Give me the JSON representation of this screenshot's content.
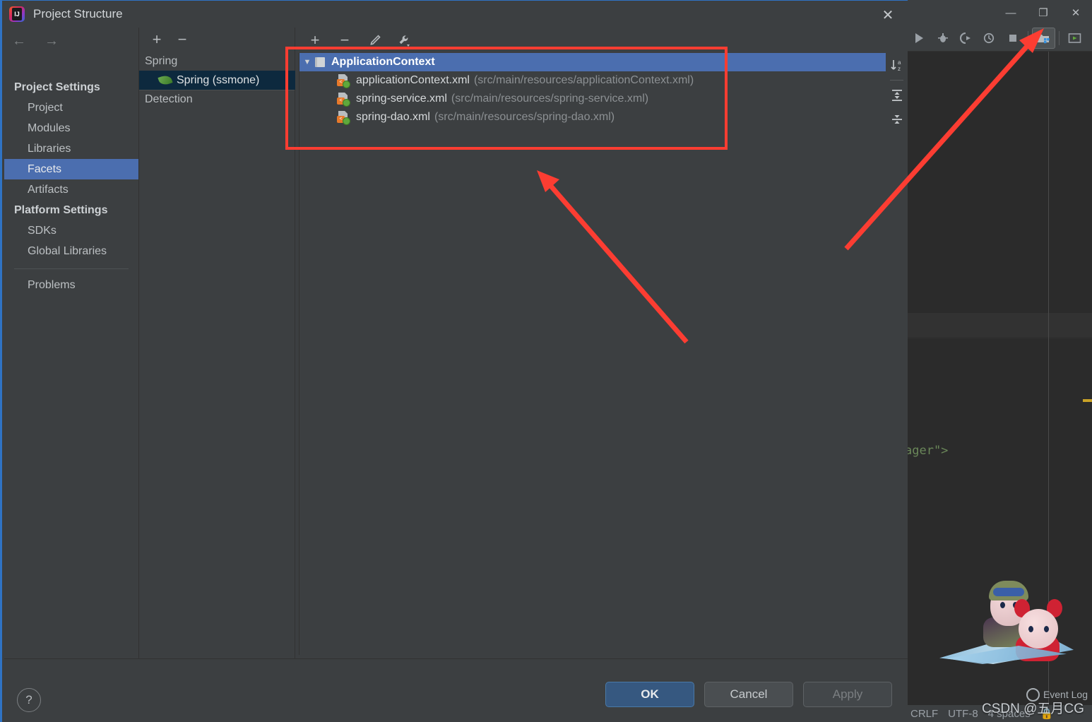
{
  "dialog": {
    "title": "Project Structure",
    "close_label": "✕",
    "nav": {
      "back": "←",
      "forward": "→"
    },
    "sidebar": {
      "groups": [
        {
          "label": "Project Settings",
          "type": "group"
        },
        {
          "label": "Project",
          "type": "item"
        },
        {
          "label": "Modules",
          "type": "item"
        },
        {
          "label": "Libraries",
          "type": "item"
        },
        {
          "label": "Facets",
          "type": "item",
          "selected": true
        },
        {
          "label": "Artifacts",
          "type": "item"
        },
        {
          "label": "Platform Settings",
          "type": "group"
        },
        {
          "label": "SDKs",
          "type": "item"
        },
        {
          "label": "Global Libraries",
          "type": "item"
        }
      ],
      "after_divider": [
        {
          "label": "Problems",
          "type": "item"
        }
      ]
    },
    "facets_panel": {
      "toolbar": {
        "add": "+",
        "remove": "−"
      },
      "header": "Spring",
      "selected_facet": "Spring (ssmone)",
      "facet_icon": "spring-leaf-icon",
      "section2": "Detection"
    },
    "content_panel": {
      "toolbar": {
        "add": "+",
        "remove": "−",
        "edit": "pencil-icon",
        "settings": "wrench-icon"
      },
      "tree": [
        {
          "label": "ApplicationContext",
          "path": "",
          "level": 0,
          "selected": true,
          "expanded": true,
          "icon": "application-context-icon"
        },
        {
          "label": "applicationContext.xml",
          "path": "(src/main/resources/applicationContext.xml)",
          "level": 1,
          "selected": false,
          "icon": "spring-xml-file-icon"
        },
        {
          "label": "spring-service.xml",
          "path": "(src/main/resources/spring-service.xml)",
          "level": 1,
          "selected": false,
          "icon": "spring-xml-file-icon"
        },
        {
          "label": "spring-dao.xml",
          "path": "(src/main/resources/spring-dao.xml)",
          "level": 1,
          "selected": false,
          "icon": "spring-xml-file-icon"
        }
      ],
      "rail": {
        "sort": "sort-alphabetically-icon",
        "expand_all": "expand-all-icon",
        "collapse_all": "collapse-all-icon"
      }
    },
    "footer": {
      "help": "?",
      "ok": "OK",
      "cancel": "Cancel",
      "apply": "Apply"
    }
  },
  "ide": {
    "window_controls": {
      "minimize": "—",
      "restore": "❐",
      "close": "✕"
    },
    "toolbar_icons": [
      "run-icon",
      "debug-icon",
      "run-with-coverage-icon",
      "profile-icon",
      "stop-icon",
      "project-structure-icon",
      "run-anything-icon"
    ],
    "editor": {
      "code_fragment": "ager\">"
    },
    "status_bar": {
      "line_sep": "CRLF",
      "encoding": "UTF-8",
      "indent": "4 spaces",
      "event_log": "Event Log"
    }
  },
  "watermark": "CSDN @五月CG",
  "colors": {
    "accent_blue": "#4b6eaf",
    "selection_dark": "#0d293e",
    "annotation_red": "#fc3d32",
    "dialog_bg": "#3c3f41",
    "editor_bg": "#2b2b2b",
    "primary_button": "#365880"
  }
}
